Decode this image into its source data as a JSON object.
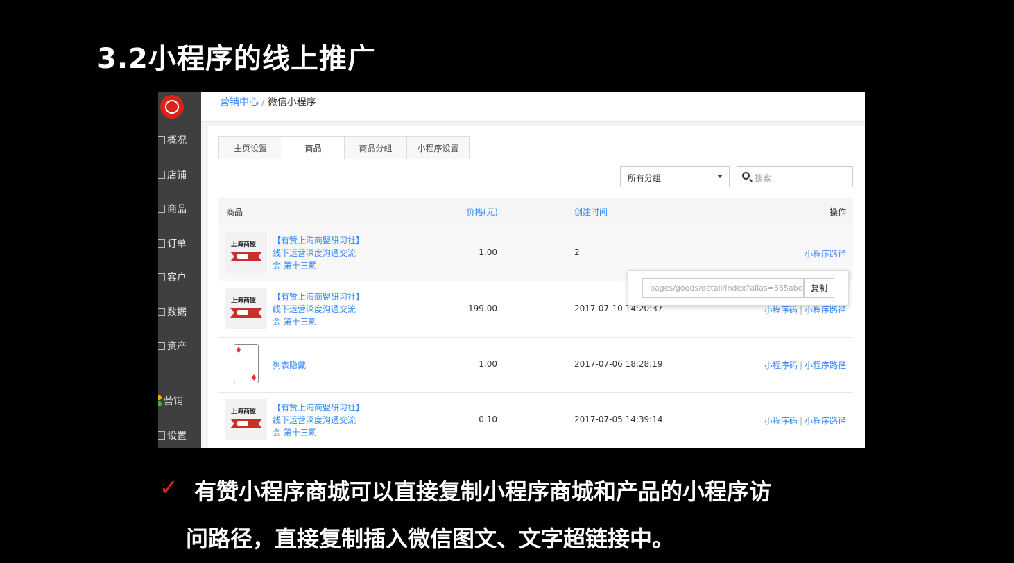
{
  "slide": {
    "title": "3.2小程序的线上推广",
    "bullet_line1": "有赞小程序商城可以直接复制小程序商城和产品的小程序访",
    "bullet_line2": "问路径，直接复制插入微信图文、文字超链接中。",
    "check_icon": "✓"
  },
  "sidebar": {
    "items": [
      {
        "label": "概况",
        "icon": "overview-icon"
      },
      {
        "label": "店铺",
        "icon": "store-icon"
      },
      {
        "label": "商品",
        "icon": "goods-icon"
      },
      {
        "label": "订单",
        "icon": "order-icon"
      },
      {
        "label": "客户",
        "icon": "customer-icon"
      },
      {
        "label": "数据",
        "icon": "data-icon"
      },
      {
        "label": "资产",
        "icon": "asset-icon"
      },
      {
        "label": "营销",
        "icon": "marketing-icon"
      },
      {
        "label": "设置",
        "icon": "settings-icon"
      }
    ]
  },
  "breadcrumb": {
    "parent": "营销中心",
    "separator": "/",
    "current": "微信小程序"
  },
  "tabs": [
    "主页设置",
    "商品",
    "商品分组",
    "小程序设置"
  ],
  "filters": {
    "group_select": "所有分组",
    "search_placeholder": "搜索"
  },
  "table": {
    "headers": {
      "goods": "商品",
      "price": "价格(元)",
      "time": "创建时间",
      "op": "操作"
    },
    "rows": [
      {
        "name": "【有赞上海商盟研习社】线下运营深度沟通交流会 第十三期",
        "price": "1.00",
        "time": "2",
        "thumb_text": "上海商盟"
      },
      {
        "name": "【有赞上海商盟研习社】线下运营深度沟通交流会 第十三期",
        "price": "199.00",
        "time": "2017-07-10 14:20:37",
        "thumb_text": "上海商盟"
      },
      {
        "name": "列表隐藏",
        "price": "1.00",
        "time": "2017-07-06 18:28:19"
      },
      {
        "name": "【有赞上海商盟研习社】线下运营深度沟通交流会 第十三期",
        "price": "0.10",
        "time": "2017-07-05 14:39:14",
        "thumb_text": "上海商盟"
      }
    ],
    "op_code": "小程序码",
    "op_path": "小程序路径",
    "op_sep": "|"
  },
  "popover": {
    "path_value": "pages/goods/detail/index?alias=365abe",
    "copy_label": "复制"
  },
  "colors": {
    "accent": "#3388ff",
    "sidebar_bg": "#3f3f3f",
    "logo": "#d9231b",
    "check": "#e0291f"
  }
}
